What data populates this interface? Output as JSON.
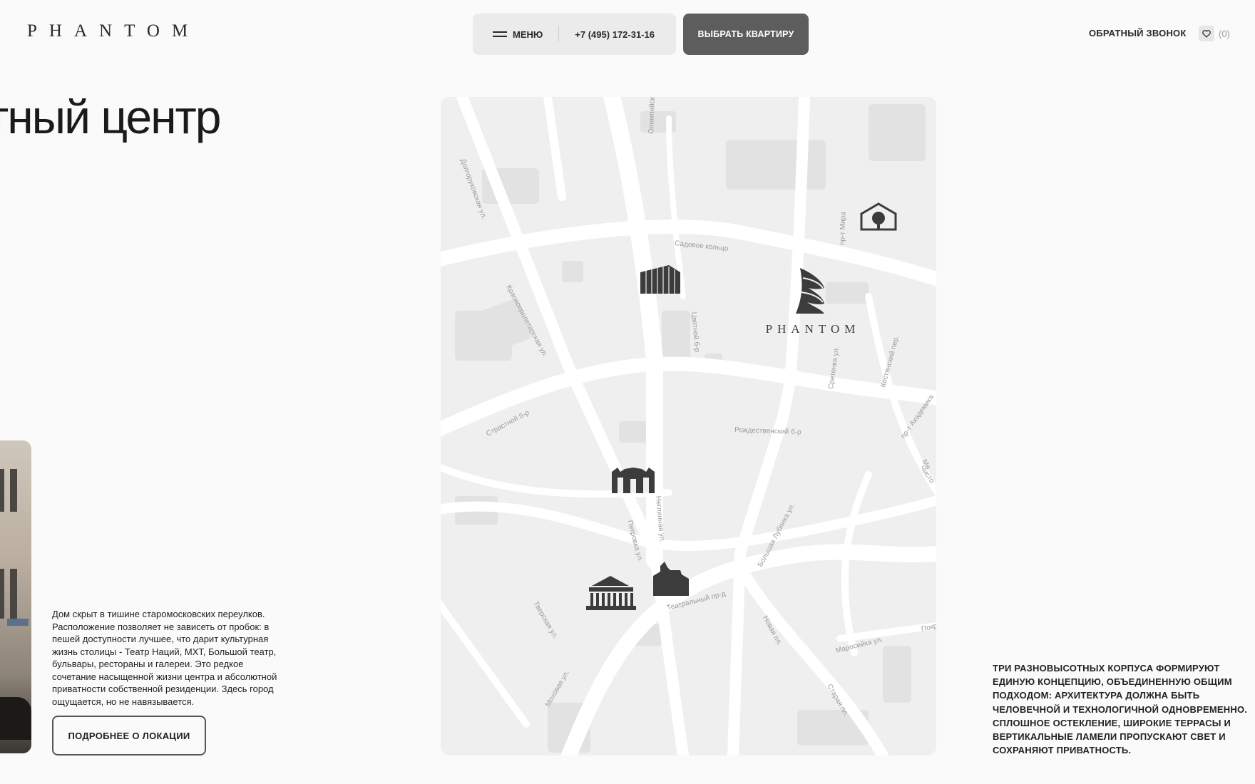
{
  "header": {
    "logo": "PHANTOM",
    "menu_label": "МЕНЮ",
    "phone": "+7 (495) 172-31-16",
    "cta_label": "ВЫБРАТЬ КВАРТИРУ",
    "callback_label": "ОБРАТНЫЙ ЗВОНОК",
    "favorites_count": "(0)"
  },
  "hero": {
    "heading": "тный центр"
  },
  "location": {
    "description": "Дом скрыт в тишине старомосковских переулков. Расположение позволяет не зависеть от пробок: в пешей доступности лучшее, что дарит культурная жизнь столицы - Театр Наций, МХТ, Большой театр, бульвары, рестораны и галереи. Это редкое сочетание насыщенной жизни центра и абсолютной приватности собственной резиденции. Здесь город ощущается, но не навязывается.",
    "more_label": "ПОДРОБНЕЕ О ЛОКАЦИИ"
  },
  "map": {
    "project_label": "PHANTOM",
    "streets": {
      "dolgorukovskaya": "Долгоруковская ул.",
      "olimpiyskiy": "Олимпийский пр-т",
      "sadovoe": "Садовое кольцо",
      "prospekt_mira": "пр-т Мира",
      "krasnoproletarskaya": "Краснопролетарская ул.",
      "tsvetnoy": "Цветной б-р",
      "sretenka": "Сретенка ул.",
      "kostyansky": "Костянский пер.",
      "strastnoy": "Страстной б-р",
      "rozhdestvensky": "Рождественский б-р",
      "akademika": "пр-т Академика",
      "chistoprudny": "Чисто",
      "neglinnaya": "Неглинная ул.",
      "petrovka": "Петровка ул.",
      "bolshaya_lubyanka": "Большая Лубянка ул.",
      "tverskaya": "Тверская ул.",
      "teatralny": "Театральный пр-д",
      "novaya": "Новая пл.",
      "maroseyka": "Маросейка ул.",
      "pokrovka": "Покр",
      "mokhovaya": "Моховая ул.",
      "staraya": "Старая пл.",
      "myas": "Мя"
    }
  },
  "architecture": {
    "text": "ТРИ РАЗНОВЫСОТНЫХ КОРПУСА ФОРМИРУЮТ ЕДИНУЮ КОНЦЕПЦИЮ, ОБЪЕДИНЕННУЮ ОБЩИМ ПОДХОДОМ: АРХИТЕКТУРА ДОЛЖНА БЫТЬ ЧЕЛОВЕЧНОЙ И ТЕХНОЛОГИЧНОЙ ОДНОВРЕМЕННО. СПЛОШНОЕ ОСТЕКЛЕНИЕ, ШИРОКИЕ ТЕРРАСЫ И ВЕРТИКАЛЬНЫЕ ЛАМЕЛИ ПРОПУСКАЮТ СВЕТ И СОХРАНЯЮТ ПРИВАТНОСТЬ."
  },
  "colors": {
    "background": "#fafafa",
    "cta_bg": "#5d5d5d",
    "pill_bg": "#ebebeb",
    "map_bg": "#efefef",
    "map_road": "#ffffff",
    "map_block": "#e2e2e2",
    "icon": "#3c3c3c"
  }
}
